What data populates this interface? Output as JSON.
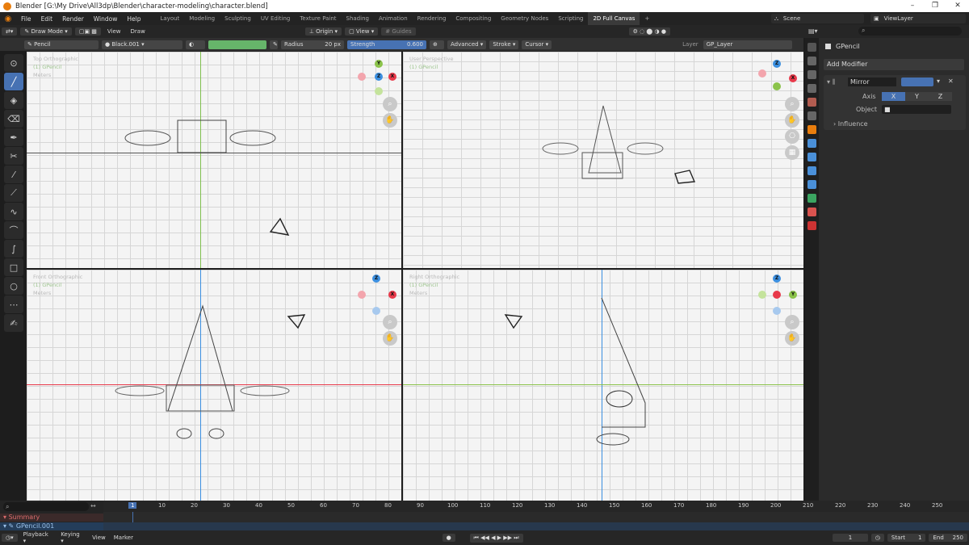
{
  "window": {
    "title": "Blender [G:\\My Drive\\All3dp\\Blender\\character-modeling\\character.blend]",
    "minimize": "–",
    "maximize": "❐",
    "close": "✕"
  },
  "menu": [
    "File",
    "Edit",
    "Render",
    "Window",
    "Help"
  ],
  "workspaces": [
    {
      "label": "Layout"
    },
    {
      "label": "Modeling"
    },
    {
      "label": "Sculpting"
    },
    {
      "label": "UV Editing"
    },
    {
      "label": "Texture Paint"
    },
    {
      "label": "Shading"
    },
    {
      "label": "Animation"
    },
    {
      "label": "Rendering"
    },
    {
      "label": "Compositing"
    },
    {
      "label": "Geometry Nodes"
    },
    {
      "label": "Scripting"
    },
    {
      "label": "2D Full Canvas",
      "active": true
    }
  ],
  "scene": "Scene",
  "view_layer": "ViewLayer",
  "header": {
    "mode": "Draw Mode",
    "view": "View",
    "draw": "Draw",
    "origin": "Origin",
    "view2": "View",
    "guides": "Guides"
  },
  "tool": {
    "brush": "Pencil",
    "material": "Black.001",
    "radius_label": "Radius",
    "radius": "20 px",
    "strength_label": "Strength",
    "strength": "0.600",
    "advanced": "Advanced",
    "stroke": "Stroke",
    "cursor": "Cursor",
    "layer_label": "Layer",
    "layer": "GP_Layer",
    "color": "#66b56a"
  },
  "viewports": [
    {
      "name": "Top Orthographic",
      "obj": "(1) GPencil",
      "units": "Meters"
    },
    {
      "name": "User Perspective",
      "obj": "(1) GPencil",
      "units": ""
    },
    {
      "name": "Front Orthographic",
      "obj": "(1) GPencil",
      "units": "Meters"
    },
    {
      "name": "Right Orthographic",
      "obj": "(1) GPencil",
      "units": "Meters"
    }
  ],
  "gizmo": {
    "x": "X",
    "y": "Y",
    "z": "Z",
    "x_color": "#e8394a",
    "y_color": "#8bc34a",
    "z_color": "#3b8fe0"
  },
  "properties": {
    "object": "GPencil",
    "add_modifier": "Add Modifier",
    "modifier": "Mirror",
    "axis_label": "Axis",
    "axes": [
      "X",
      "Y",
      "Z"
    ],
    "object_label": "Object",
    "influence": "Influence"
  },
  "timeline": {
    "frames": [
      "1",
      "10",
      "20",
      "30",
      "40",
      "50",
      "60",
      "70",
      "80",
      "90",
      "100",
      "110",
      "120",
      "130",
      "140",
      "150",
      "160",
      "170",
      "180",
      "190",
      "200",
      "210",
      "220",
      "230",
      "240",
      "250"
    ],
    "summary": "Summary",
    "track": "GPencil.001"
  },
  "playback": {
    "playback": "Playback",
    "keying": "Keying",
    "view": "View",
    "marker": "Marker",
    "current": "1",
    "start_label": "Start",
    "start": "1",
    "end_label": "End",
    "end": "250"
  }
}
